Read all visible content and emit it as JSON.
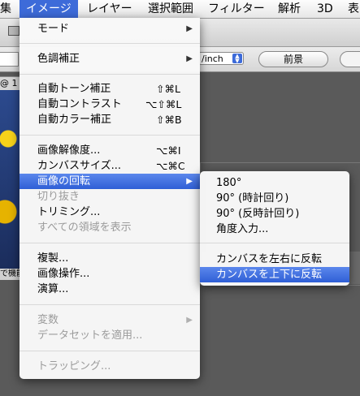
{
  "menubar": {
    "items": [
      {
        "label": "集",
        "active": false
      },
      {
        "label": "イメージ",
        "active": true
      },
      {
        "label": "レイヤー",
        "active": false
      },
      {
        "label": "選択範囲",
        "active": false
      },
      {
        "label": "フィルター",
        "active": false
      },
      {
        "label": "解析",
        "active": false
      },
      {
        "label": "3D",
        "active": false
      },
      {
        "label": "表",
        "active": false
      }
    ]
  },
  "options_bar": {
    "units_value": "/inch",
    "front_button": "前景"
  },
  "document": {
    "tab_label": "@ 1",
    "status_text": "で機能"
  },
  "image_menu": {
    "items": [
      {
        "label": "モード",
        "shortcut": "",
        "submenu": true,
        "disabled": false
      },
      {
        "label": "色調補正",
        "shortcut": "",
        "submenu": true,
        "disabled": false
      },
      {
        "label": "自動トーン補正",
        "shortcut": "⇧⌘L",
        "submenu": false,
        "disabled": false
      },
      {
        "label": "自動コントラスト",
        "shortcut": "⌥⇧⌘L",
        "submenu": false,
        "disabled": false
      },
      {
        "label": "自動カラー補正",
        "shortcut": "⇧⌘B",
        "submenu": false,
        "disabled": false
      },
      {
        "label": "画像解像度...",
        "shortcut": "⌥⌘I",
        "submenu": false,
        "disabled": false
      },
      {
        "label": "カンバスサイズ...",
        "shortcut": "⌥⌘C",
        "submenu": false,
        "disabled": false
      },
      {
        "label": "画像の回転",
        "shortcut": "",
        "submenu": true,
        "disabled": false,
        "highlighted": true
      },
      {
        "label": "切り抜き",
        "shortcut": "",
        "submenu": false,
        "disabled": true
      },
      {
        "label": "トリミング...",
        "shortcut": "",
        "submenu": false,
        "disabled": false
      },
      {
        "label": "すべての領域を表示",
        "shortcut": "",
        "submenu": false,
        "disabled": true
      },
      {
        "label": "複製...",
        "shortcut": "",
        "submenu": false,
        "disabled": false
      },
      {
        "label": "画像操作...",
        "shortcut": "",
        "submenu": false,
        "disabled": false
      },
      {
        "label": "演算...",
        "shortcut": "",
        "submenu": false,
        "disabled": false
      },
      {
        "label": "変数",
        "shortcut": "",
        "submenu": true,
        "disabled": true
      },
      {
        "label": "データセットを適用...",
        "shortcut": "",
        "submenu": false,
        "disabled": true
      },
      {
        "label": "トラッピング...",
        "shortcut": "",
        "submenu": false,
        "disabled": true
      }
    ]
  },
  "rotate_submenu": {
    "items": [
      {
        "label": "180°",
        "highlighted": false
      },
      {
        "label": "90° (時計回り)",
        "highlighted": false
      },
      {
        "label": "90° (反時計回り)",
        "highlighted": false
      },
      {
        "label": "角度入力...",
        "highlighted": false
      },
      {
        "label": "カンバスを左右に反転",
        "highlighted": false
      },
      {
        "label": "カンバスを上下に反転",
        "highlighted": true
      }
    ]
  },
  "colors": {
    "highlight": "#3d6bd9",
    "disabled_text": "#9b9b9b"
  }
}
